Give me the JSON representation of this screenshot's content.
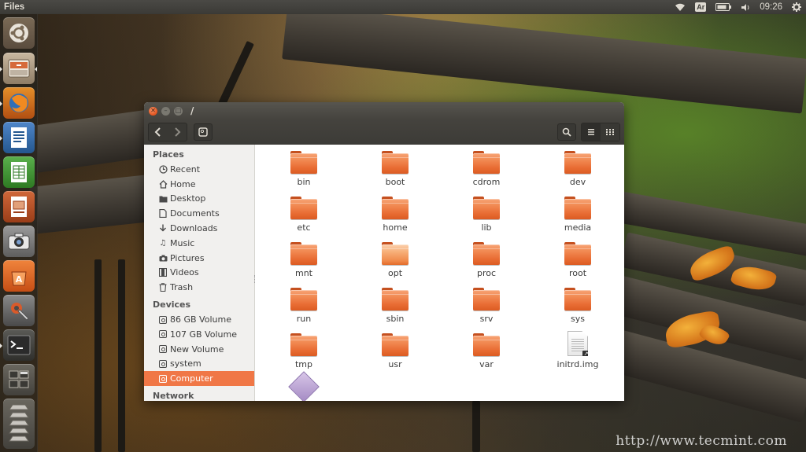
{
  "top_panel": {
    "app_title": "Files",
    "keyboard_layout": "Ar",
    "clock": "09:26"
  },
  "launcher": {
    "items": [
      {
        "name": "ubuntu-dash",
        "icon": "ubuntu-logo-icon"
      },
      {
        "name": "files",
        "icon": "file-cabinet-icon"
      },
      {
        "name": "firefox",
        "icon": "firefox-icon"
      },
      {
        "name": "libreoffice-writer",
        "icon": "writer-icon"
      },
      {
        "name": "libreoffice-calc",
        "icon": "calc-icon"
      },
      {
        "name": "libreoffice-impress",
        "icon": "impress-icon"
      },
      {
        "name": "shotwell",
        "icon": "camera-icon"
      },
      {
        "name": "software-center",
        "icon": "shopping-bag-icon"
      },
      {
        "name": "system-settings",
        "icon": "wrench-gear-icon"
      },
      {
        "name": "terminal",
        "icon": "terminal-icon"
      },
      {
        "name": "workspaces",
        "icon": "workspace-switcher-icon"
      },
      {
        "name": "trash",
        "icon": "trash-icon"
      }
    ]
  },
  "window": {
    "title": "/",
    "sidebar": {
      "places_header": "Places",
      "places": [
        {
          "label": "Recent",
          "icon": "clock-icon"
        },
        {
          "label": "Home",
          "icon": "home-icon"
        },
        {
          "label": "Desktop",
          "icon": "folder-icon"
        },
        {
          "label": "Documents",
          "icon": "document-icon"
        },
        {
          "label": "Downloads",
          "icon": "download-icon"
        },
        {
          "label": "Music",
          "icon": "music-icon"
        },
        {
          "label": "Pictures",
          "icon": "camera-icon"
        },
        {
          "label": "Videos",
          "icon": "film-icon"
        },
        {
          "label": "Trash",
          "icon": "trash-icon"
        }
      ],
      "devices_header": "Devices",
      "devices": [
        {
          "label": "86 GB Volume",
          "icon": "drive-icon"
        },
        {
          "label": "107 GB Volume",
          "icon": "drive-icon"
        },
        {
          "label": "New Volume",
          "icon": "drive-icon"
        },
        {
          "label": "system",
          "icon": "drive-icon"
        },
        {
          "label": "Computer",
          "icon": "computer-icon",
          "selected": true
        }
      ],
      "network_header": "Network"
    },
    "files": [
      "bin",
      "boot",
      "cdrom",
      "dev",
      "etc",
      "home",
      "lib",
      "media",
      "mnt",
      "opt",
      "proc",
      "root",
      "run",
      "sbin",
      "srv",
      "sys",
      "tmp",
      "usr",
      "var",
      "initrd.img"
    ]
  },
  "watermark": "http://www.tecmint.com"
}
